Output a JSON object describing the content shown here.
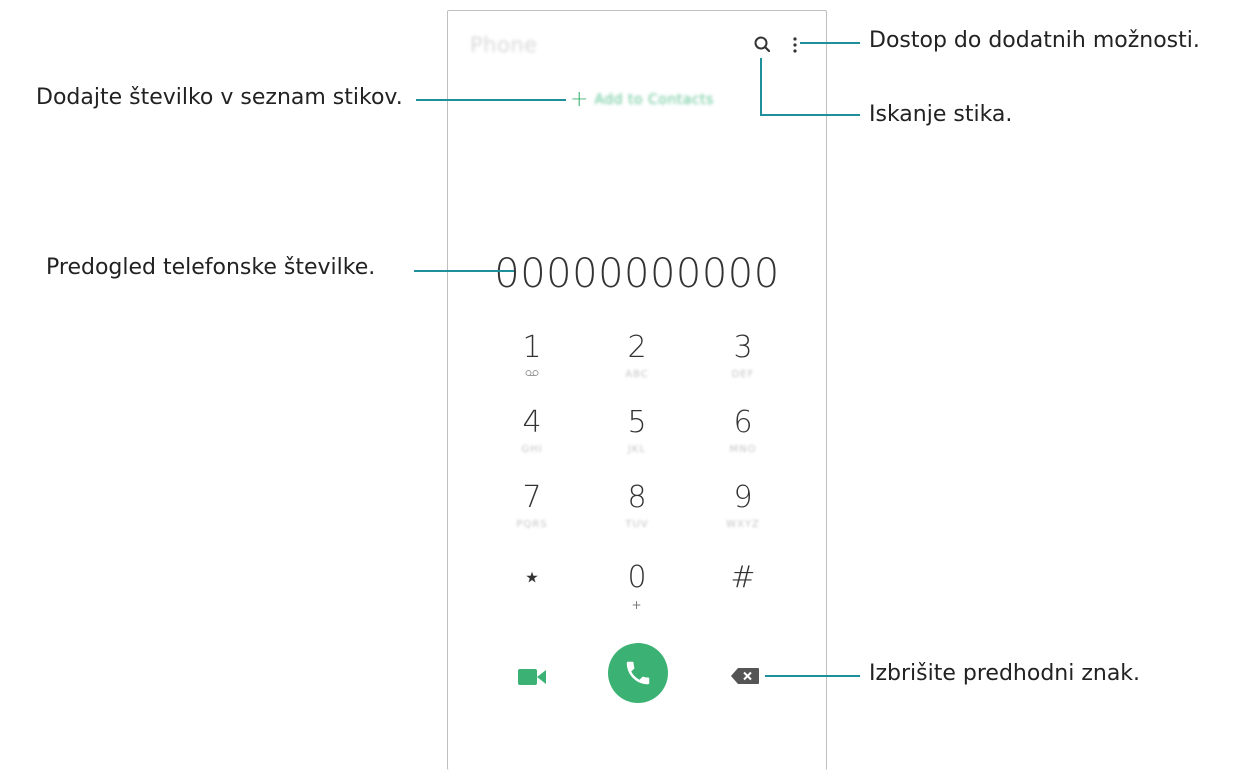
{
  "phone": {
    "app_title": "Phone",
    "add_contact_label": "Add to Contacts",
    "number": "00000000000"
  },
  "keypad": [
    {
      "digit": "1",
      "sub": "voicemail-icon"
    },
    {
      "digit": "2",
      "sub": "ABC"
    },
    {
      "digit": "3",
      "sub": "DEF"
    },
    {
      "digit": "4",
      "sub": "GHI"
    },
    {
      "digit": "5",
      "sub": "JKL"
    },
    {
      "digit": "6",
      "sub": "MNO"
    },
    {
      "digit": "7",
      "sub": "PQRS"
    },
    {
      "digit": "8",
      "sub": "TUV"
    },
    {
      "digit": "9",
      "sub": "WXYZ"
    },
    {
      "digit": "⋆",
      "sub": ""
    },
    {
      "digit": "0",
      "sub": "+"
    },
    {
      "digit": "#",
      "sub": ""
    }
  ],
  "icons": {
    "search": "search-icon",
    "more": "more-options-icon",
    "add": "plus-icon",
    "voicemail": "voicemail-icon",
    "video": "video-call-icon",
    "call": "phone-call-icon",
    "backspace": "backspace-icon"
  },
  "colors": {
    "accent_green": "#3bb273",
    "leader_line": "#1f8f9b",
    "text": "#222222",
    "muted": "#c4c4c4"
  },
  "callouts": {
    "more_options": "Dostop do dodatnih možnosti.",
    "add_contact": "Dodajte številko v seznam stikov.",
    "search": "Iskanje stika.",
    "number_preview": "Predogled telefonske številke.",
    "delete": "Izbrišite predhodni znak."
  }
}
